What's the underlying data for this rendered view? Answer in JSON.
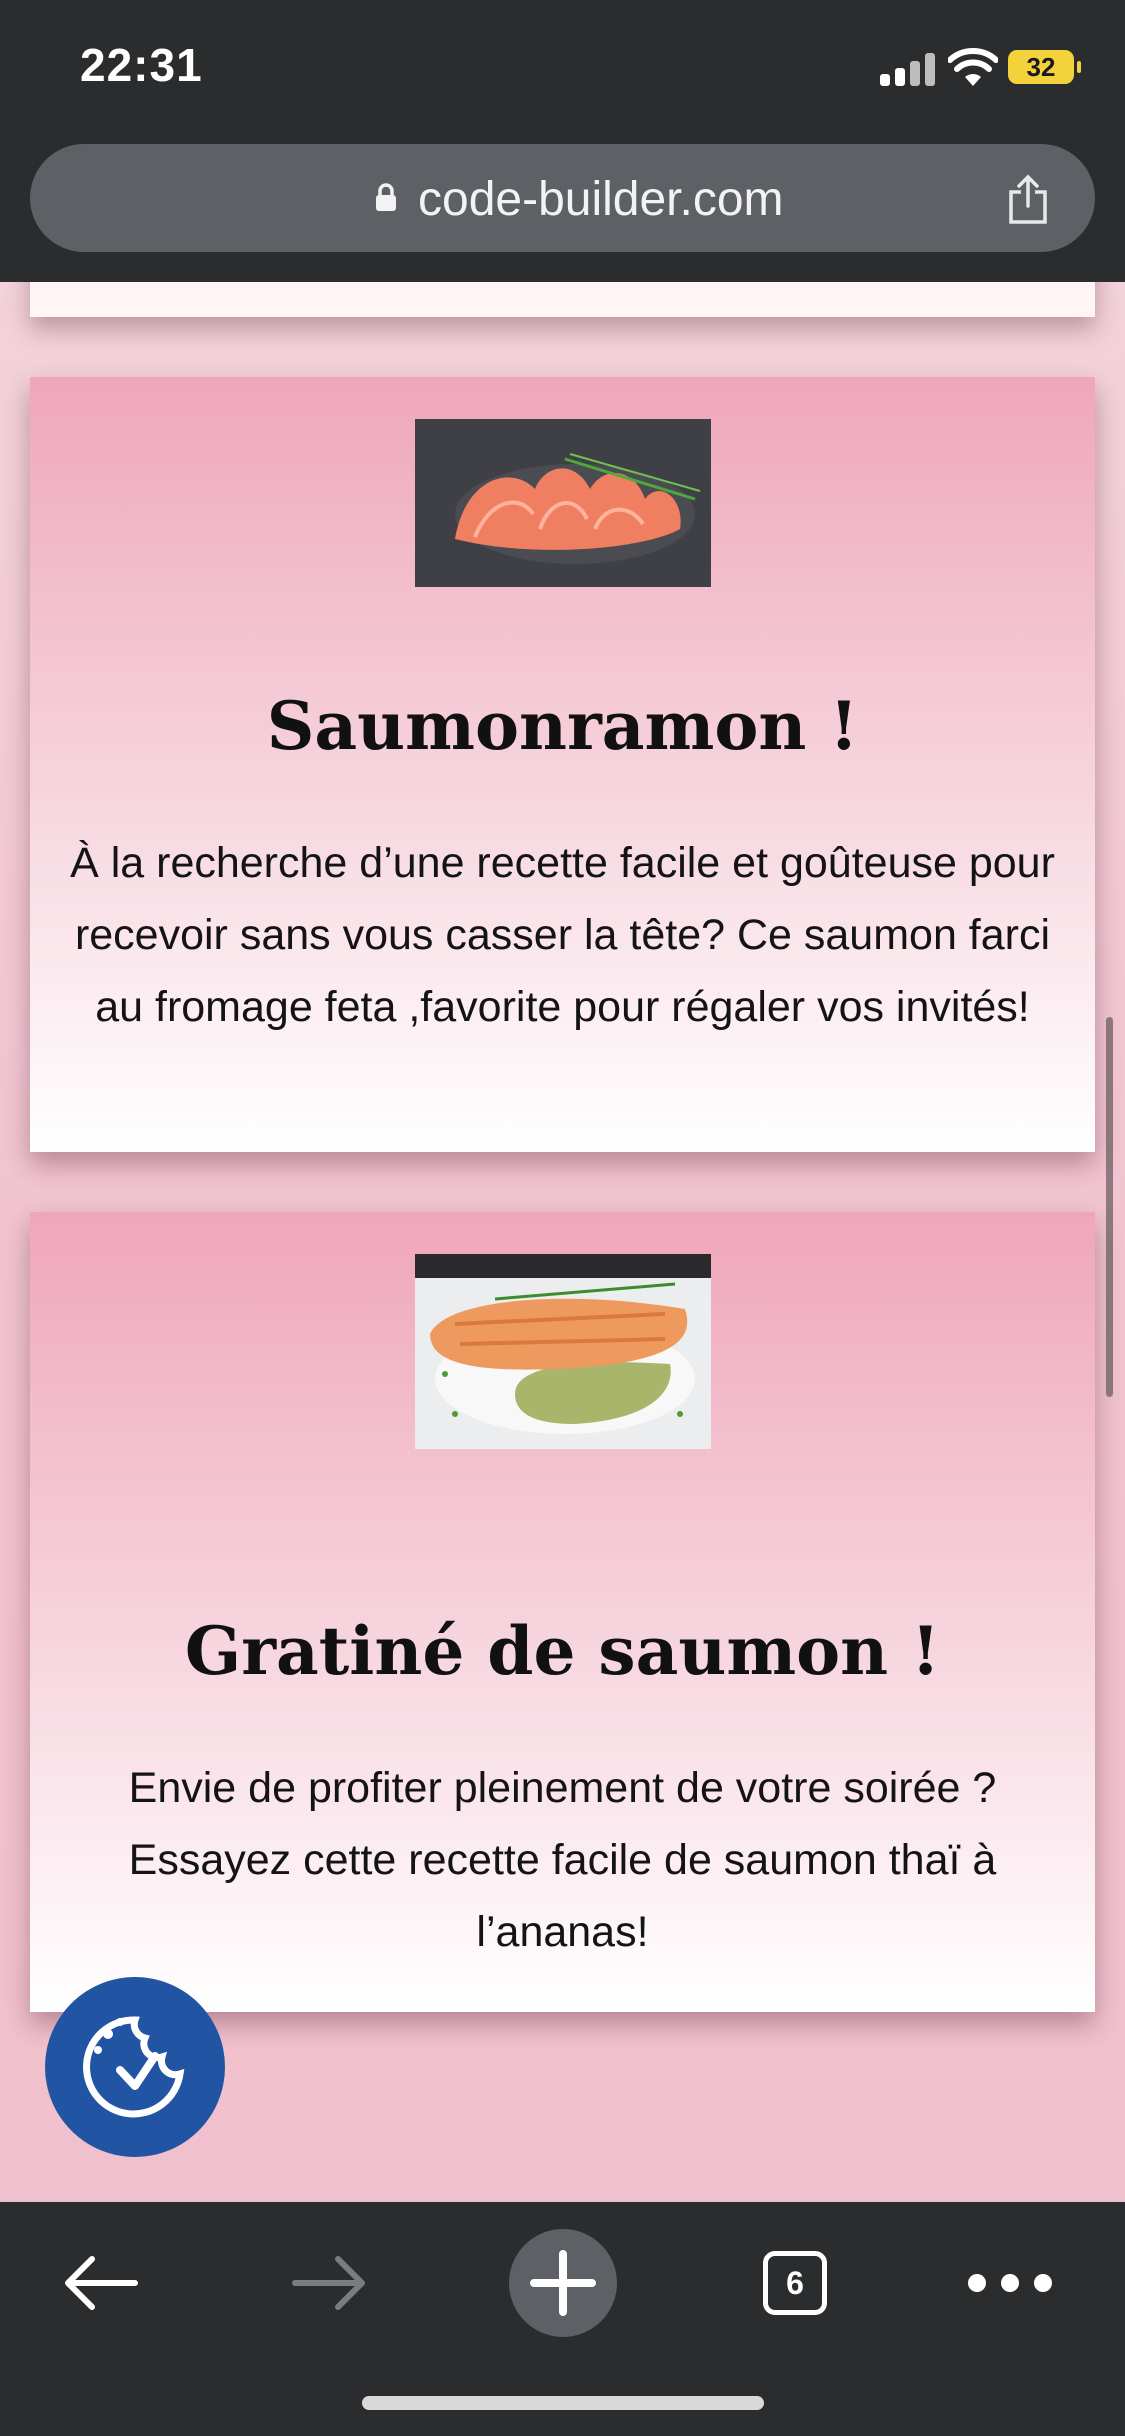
{
  "status_bar": {
    "time": "22:31",
    "battery_level": "32",
    "icons": [
      "signal-icon",
      "wifi-icon",
      "battery-icon"
    ]
  },
  "address_bar": {
    "url": "code-builder.com",
    "icons": [
      "lock-icon",
      "share-icon"
    ]
  },
  "recipes": [
    {
      "photo": "smoked-salmon-slices-photo",
      "title": "Saumonramon !",
      "description": "À la recherche d’une recette facile et goûteuse pour recevoir sans vous casser la tête? Ce saumon farci au fromage feta ,favorite pour régaler vos invités!"
    },
    {
      "photo": "salmon-gratin-photo",
      "title": "Gratiné de saumon !",
      "description": "Envie de profiter pleinement de votre soirée ? Essayez cette recette facile de saumon thaï à l’ananas!"
    }
  ],
  "cookie_consent": {
    "icon": "cookie-check-icon"
  },
  "toolbar": {
    "tab_count": "6",
    "icons": [
      "back-arrow-icon",
      "forward-arrow-icon",
      "plus-icon",
      "tabs-icon",
      "more-dots-icon"
    ]
  },
  "colors": {
    "chrome": "#2b2c2e",
    "url_pill": "#5d6064",
    "card_top": "#efa6bb",
    "card_bottom": "#ffffff",
    "cookie_button": "#2155a3",
    "battery": "#f3d23b"
  }
}
